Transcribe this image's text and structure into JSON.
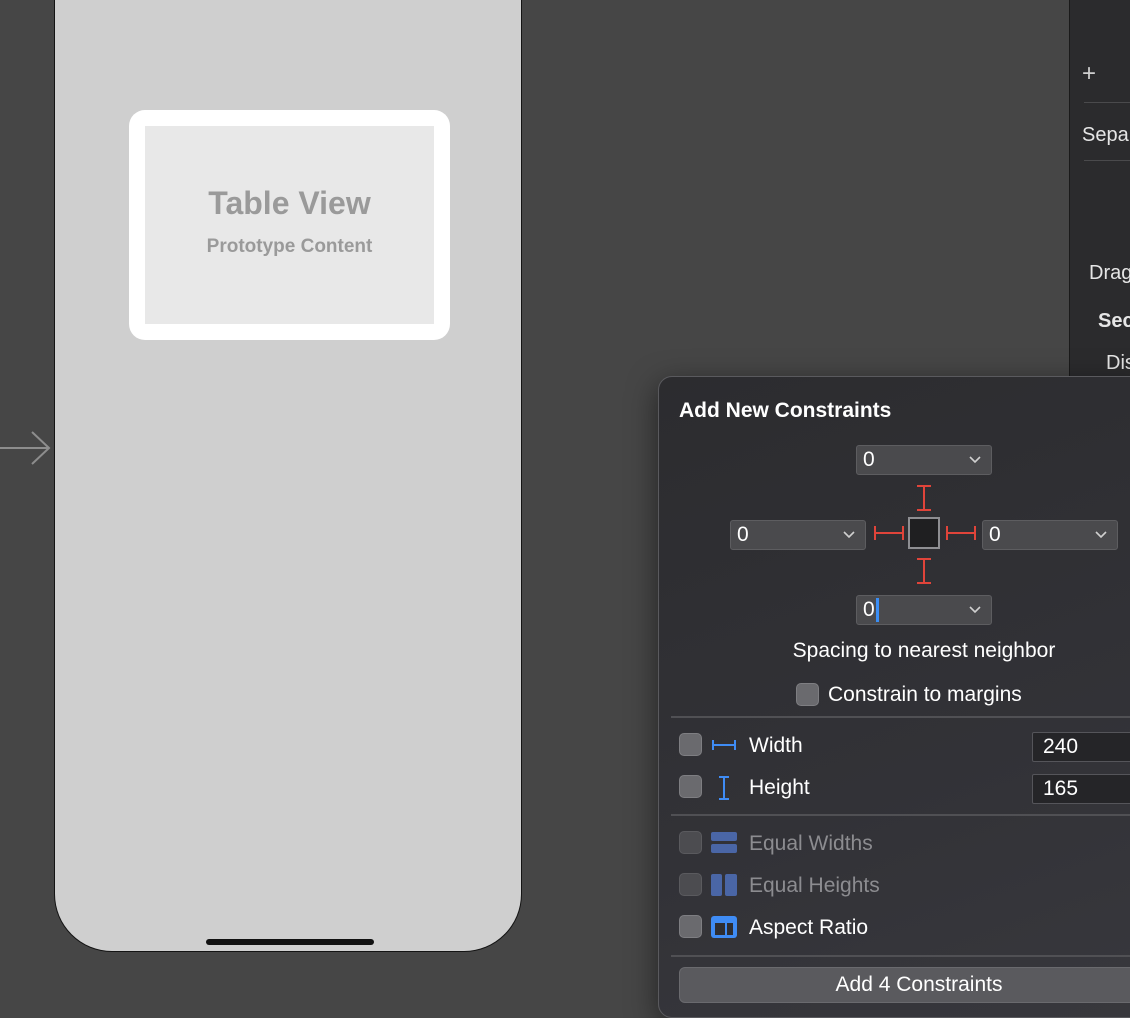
{
  "canvas": {
    "table_view": {
      "title": "Table View",
      "subtitle": "Prototype Content"
    }
  },
  "inspector": {
    "items": [
      "+",
      "Sepa",
      "Drag",
      "Sec",
      "Dis"
    ]
  },
  "popover": {
    "title": "Add New Constraints",
    "spacing": {
      "top": "0",
      "left": "0",
      "right": "0",
      "bottom": "0"
    },
    "caption": "Spacing to nearest neighbor",
    "constrain_to_margins": "Constrain to margins",
    "width_label": "Width",
    "width_value": "240",
    "height_label": "Height",
    "height_value": "165",
    "equal_widths": "Equal Widths",
    "equal_heights": "Equal Heights",
    "aspect_ratio": "Aspect Ratio",
    "add_button": "Add 4 Constraints"
  },
  "colors": {
    "canvas_bg": "#464646",
    "constraint_red": "#e0443a",
    "icon_blue": "#3f8cf5",
    "cursor_blue": "#3a8ef6"
  }
}
